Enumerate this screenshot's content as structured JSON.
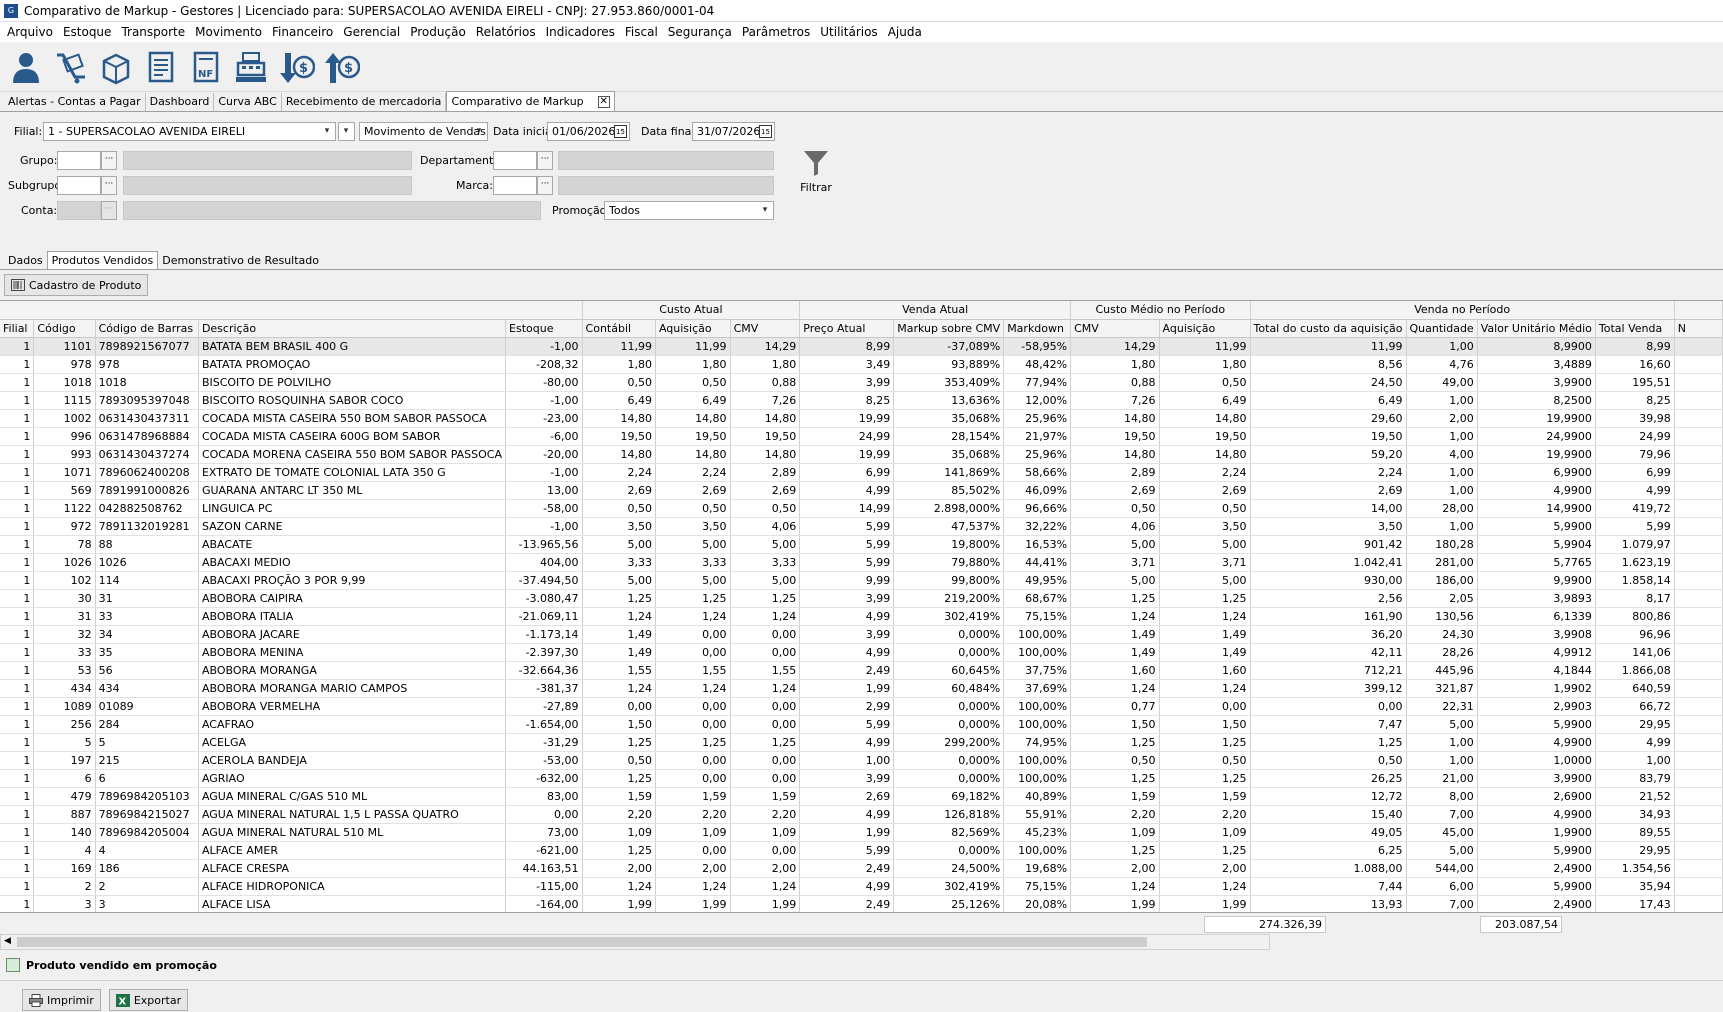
{
  "window": {
    "title": "Comparativo de Markup - Gestores | Licenciado para: SUPERSACOLAO AVENIDA EIRELI - CNPJ: 27.953.860/0001-04"
  },
  "menu": [
    "Arquivo",
    "Estoque",
    "Transporte",
    "Movimento",
    "Financeiro",
    "Gerencial",
    "Produção",
    "Relatórios",
    "Indicadores",
    "Fiscal",
    "Segurança",
    "Parâmetros",
    "Utilitários",
    "Ajuda"
  ],
  "doc_tabs": [
    "Alertas - Contas a Pagar",
    "Dashboard",
    "Curva ABC",
    "Recebimento de mercadoria",
    "Comparativo de Markup"
  ],
  "filters": {
    "filial_label": "Filial:",
    "filial_value": "1 - SUPERSACOLAO AVENIDA EIRELI",
    "movimento_value": "Movimento de Vendas",
    "data_inicial_label": "Data inicial:",
    "data_inicial_value": "01/06/2026",
    "data_final_label": "Data final:",
    "data_final_value": "31/07/2026",
    "grupo_label": "Grupo:",
    "subgrupo_label": "Subgrupo:",
    "conta_label": "Conta:",
    "departamento_label": "Departamento:",
    "marca_label": "Marca:",
    "promocao_label": "Promoção:",
    "promocao_value": "Todos",
    "filtrar_label": "Filtrar"
  },
  "sub_tabs": [
    "Dados",
    "Produtos Vendidos",
    "Demonstrativo de Resultado"
  ],
  "cadastro_button": "Cadastro de Produto",
  "table": {
    "group_headers": [
      "Custo Atual",
      "Venda Atual",
      "Custo Médio no Período",
      "Venda no Período"
    ],
    "columns": [
      "Filial",
      "Código",
      "Código de Barras",
      "Descrição",
      "Estoque",
      "Contábil",
      "Aquisição",
      "CMV",
      "Preço Atual",
      "Markup sobre CMV",
      "Markdown",
      "CMV",
      "Aquisição",
      "Total do custo da aquisição",
      "Quantidade",
      "Valor Unitário Médio",
      "Total Venda",
      "N"
    ],
    "rows": [
      [
        "1",
        "1101",
        "7898921567077",
        "BATATA BEM BRASIL 400 G",
        "-1,00",
        "11,99",
        "11,99",
        "14,29",
        "8,99",
        "-37,089%",
        "-58,95%",
        "14,29",
        "11,99",
        "11,99",
        "1,00",
        "8,9900",
        "8,99",
        ""
      ],
      [
        "1",
        "978",
        "978",
        "BATATA PROMOÇAO",
        "-208,32",
        "1,80",
        "1,80",
        "1,80",
        "3,49",
        "93,889%",
        "48,42%",
        "1,80",
        "1,80",
        "8,56",
        "4,76",
        "3,4889",
        "16,60",
        ""
      ],
      [
        "1",
        "1018",
        "1018",
        "BISCOITO DE POLVILHO",
        "-80,00",
        "0,50",
        "0,50",
        "0,88",
        "3,99",
        "353,409%",
        "77,94%",
        "0,88",
        "0,50",
        "24,50",
        "49,00",
        "3,9900",
        "195,51",
        ""
      ],
      [
        "1",
        "1115",
        "7893095397048",
        "BISCOITO ROSQUINHA SABOR COCO",
        "-1,00",
        "6,49",
        "6,49",
        "7,26",
        "8,25",
        "13,636%",
        "12,00%",
        "7,26",
        "6,49",
        "6,49",
        "1,00",
        "8,2500",
        "8,25",
        ""
      ],
      [
        "1",
        "1002",
        "0631430437311",
        "COCADA MISTA CASEIRA 550 BOM SABOR PASSOCA",
        "-23,00",
        "14,80",
        "14,80",
        "14,80",
        "19,99",
        "35,068%",
        "25,96%",
        "14,80",
        "14,80",
        "29,60",
        "2,00",
        "19,9900",
        "39,98",
        ""
      ],
      [
        "1",
        "996",
        "0631478968884",
        "COCADA MISTA CASEIRA 600G BOM SABOR",
        "-6,00",
        "19,50",
        "19,50",
        "19,50",
        "24,99",
        "28,154%",
        "21,97%",
        "19,50",
        "19,50",
        "19,50",
        "1,00",
        "24,9900",
        "24,99",
        ""
      ],
      [
        "1",
        "993",
        "0631430437274",
        "COCADA MORENA CASEIRA 550 BOM SABOR PASSOCA",
        "-20,00",
        "14,80",
        "14,80",
        "14,80",
        "19,99",
        "35,068%",
        "25,96%",
        "14,80",
        "14,80",
        "59,20",
        "4,00",
        "19,9900",
        "79,96",
        ""
      ],
      [
        "1",
        "1071",
        "7896062400208",
        "EXTRATO DE TOMATE COLONIAL LATA 350 G",
        "-1,00",
        "2,24",
        "2,24",
        "2,89",
        "6,99",
        "141,869%",
        "58,66%",
        "2,89",
        "2,24",
        "2,24",
        "1,00",
        "6,9900",
        "6,99",
        ""
      ],
      [
        "1",
        "569",
        "7891991000826",
        "GUARANA ANTARC LT 350 ML",
        "13,00",
        "2,69",
        "2,69",
        "2,69",
        "4,99",
        "85,502%",
        "46,09%",
        "2,69",
        "2,69",
        "2,69",
        "1,00",
        "4,9900",
        "4,99",
        ""
      ],
      [
        "1",
        "1122",
        "042882508762",
        "LINGUICA  PC",
        "-58,00",
        "0,50",
        "0,50",
        "0,50",
        "14,99",
        "2.898,000%",
        "96,66%",
        "0,50",
        "0,50",
        "14,00",
        "28,00",
        "14,9900",
        "419,72",
        ""
      ],
      [
        "1",
        "972",
        "7891132019281",
        "SAZON CARNE",
        "-1,00",
        "3,50",
        "3,50",
        "4,06",
        "5,99",
        "47,537%",
        "32,22%",
        "4,06",
        "3,50",
        "3,50",
        "1,00",
        "5,9900",
        "5,99",
        ""
      ],
      [
        "1",
        "78",
        "88",
        "ABACATE",
        "-13.965,56",
        "5,00",
        "5,00",
        "5,00",
        "5,99",
        "19,800%",
        "16,53%",
        "5,00",
        "5,00",
        "901,42",
        "180,28",
        "5,9904",
        "1.079,97",
        ""
      ],
      [
        "1",
        "1026",
        "1026",
        "ABACAXI MEDIO",
        "404,00",
        "3,33",
        "3,33",
        "3,33",
        "5,99",
        "79,880%",
        "44,41%",
        "3,71",
        "3,71",
        "1.042,41",
        "281,00",
        "5,7765",
        "1.623,19",
        ""
      ],
      [
        "1",
        "102",
        "114",
        "ABACAXI PROÇÃO 3 POR 9,99",
        "-37.494,50",
        "5,00",
        "5,00",
        "5,00",
        "9,99",
        "99,800%",
        "49,95%",
        "5,00",
        "5,00",
        "930,00",
        "186,00",
        "9,9900",
        "1.858,14",
        ""
      ],
      [
        "1",
        "30",
        "31",
        "ABOBORA CAIPIRA",
        "-3.080,47",
        "1,25",
        "1,25",
        "1,25",
        "3,99",
        "219,200%",
        "68,67%",
        "1,25",
        "1,25",
        "2,56",
        "2,05",
        "3,9893",
        "8,17",
        ""
      ],
      [
        "1",
        "31",
        "33",
        "ABOBORA ITALIA",
        "-21.069,11",
        "1,24",
        "1,24",
        "1,24",
        "4,99",
        "302,419%",
        "75,15%",
        "1,24",
        "1,24",
        "161,90",
        "130,56",
        "6,1339",
        "800,86",
        ""
      ],
      [
        "1",
        "32",
        "34",
        "ABOBORA JACARE",
        "-1.173,14",
        "1,49",
        "0,00",
        "0,00",
        "3,99",
        "0,000%",
        "100,00%",
        "1,49",
        "1,49",
        "36,20",
        "24,30",
        "3,9908",
        "96,96",
        ""
      ],
      [
        "1",
        "33",
        "35",
        "ABOBORA MENINA",
        "-2.397,30",
        "1,49",
        "0,00",
        "0,00",
        "4,99",
        "0,000%",
        "100,00%",
        "1,49",
        "1,49",
        "42,11",
        "28,26",
        "4,9912",
        "141,06",
        ""
      ],
      [
        "1",
        "53",
        "56",
        "ABOBORA MORANGA",
        "-32.664,36",
        "1,55",
        "1,55",
        "1,55",
        "2,49",
        "60,645%",
        "37,75%",
        "1,60",
        "1,60",
        "712,21",
        "445,96",
        "4,1844",
        "1.866,08",
        ""
      ],
      [
        "1",
        "434",
        "434",
        "ABOBORA MORANGA MARIO CAMPOS",
        "-381,37",
        "1,24",
        "1,24",
        "1,24",
        "1,99",
        "60,484%",
        "37,69%",
        "1,24",
        "1,24",
        "399,12",
        "321,87",
        "1,9902",
        "640,59",
        ""
      ],
      [
        "1",
        "1089",
        "01089",
        "ABOBORA VERMELHA",
        "-27,89",
        "0,00",
        "0,00",
        "0,00",
        "2,99",
        "0,000%",
        "100,00%",
        "0,77",
        "0,00",
        "0,00",
        "22,31",
        "2,9903",
        "66,72",
        ""
      ],
      [
        "1",
        "256",
        "284",
        "ACAFRAO",
        "-1.654,00",
        "1,50",
        "0,00",
        "0,00",
        "5,99",
        "0,000%",
        "100,00%",
        "1,50",
        "1,50",
        "7,47",
        "5,00",
        "5,9900",
        "29,95",
        ""
      ],
      [
        "1",
        "5",
        "5",
        "ACELGA",
        "-31,29",
        "1,25",
        "1,25",
        "1,25",
        "4,99",
        "299,200%",
        "74,95%",
        "1,25",
        "1,25",
        "1,25",
        "1,00",
        "4,9900",
        "4,99",
        ""
      ],
      [
        "1",
        "197",
        "215",
        "ACEROLA BANDEJA",
        "-53,00",
        "0,50",
        "0,00",
        "0,00",
        "1,00",
        "0,000%",
        "100,00%",
        "0,50",
        "0,50",
        "0,50",
        "1,00",
        "1,0000",
        "1,00",
        ""
      ],
      [
        "1",
        "6",
        "6",
        "AGRIAO",
        "-632,00",
        "1,25",
        "0,00",
        "0,00",
        "3,99",
        "0,000%",
        "100,00%",
        "1,25",
        "1,25",
        "26,25",
        "21,00",
        "3,9900",
        "83,79",
        ""
      ],
      [
        "1",
        "479",
        "7896984205103",
        "AGUA MINERAL C/GAS 510 ML",
        "83,00",
        "1,59",
        "1,59",
        "1,59",
        "2,69",
        "69,182%",
        "40,89%",
        "1,59",
        "1,59",
        "12,72",
        "8,00",
        "2,6900",
        "21,52",
        ""
      ],
      [
        "1",
        "887",
        "7896984215027",
        "AGUA MINERAL NATURAL 1,5 L PASSA QUATRO",
        "0,00",
        "2,20",
        "2,20",
        "2,20",
        "4,99",
        "126,818%",
        "55,91%",
        "2,20",
        "2,20",
        "15,40",
        "7,00",
        "4,9900",
        "34,93",
        ""
      ],
      [
        "1",
        "140",
        "7896984205004",
        "AGUA MINERAL NATURAL 510 ML",
        "73,00",
        "1,09",
        "1,09",
        "1,09",
        "1,99",
        "82,569%",
        "45,23%",
        "1,09",
        "1,09",
        "49,05",
        "45,00",
        "1,9900",
        "89,55",
        ""
      ],
      [
        "1",
        "4",
        "4",
        "ALFACE AMER",
        "-621,00",
        "1,25",
        "0,00",
        "0,00",
        "5,99",
        "0,000%",
        "100,00%",
        "1,25",
        "1,25",
        "6,25",
        "5,00",
        "5,9900",
        "29,95",
        ""
      ],
      [
        "1",
        "169",
        "186",
        "ALFACE CRESPA",
        "44.163,51",
        "2,00",
        "2,00",
        "2,00",
        "2,49",
        "24,500%",
        "19,68%",
        "2,00",
        "2,00",
        "1.088,00",
        "544,00",
        "2,4900",
        "1.354,56",
        ""
      ],
      [
        "1",
        "2",
        "2",
        "ALFACE HIDROPONICA",
        "-115,00",
        "1,24",
        "1,24",
        "1,24",
        "4,99",
        "302,419%",
        "75,15%",
        "1,24",
        "1,24",
        "7,44",
        "6,00",
        "5,9900",
        "35,94",
        ""
      ],
      [
        "1",
        "3",
        "3",
        "ALFACE LISA",
        "-164,00",
        "1,99",
        "1,99",
        "1,99",
        "2,49",
        "25,126%",
        "20,08%",
        "1,99",
        "1,99",
        "13,93",
        "7,00",
        "2,4900",
        "17,43",
        ""
      ]
    ],
    "totals": {
      "total_custo": "274.326,39",
      "total_venda": "203.087,54"
    }
  },
  "legend_label": "Produto vendido em promoção",
  "buttons": {
    "imprimir": "Imprimir",
    "exportar": "Exportar"
  }
}
